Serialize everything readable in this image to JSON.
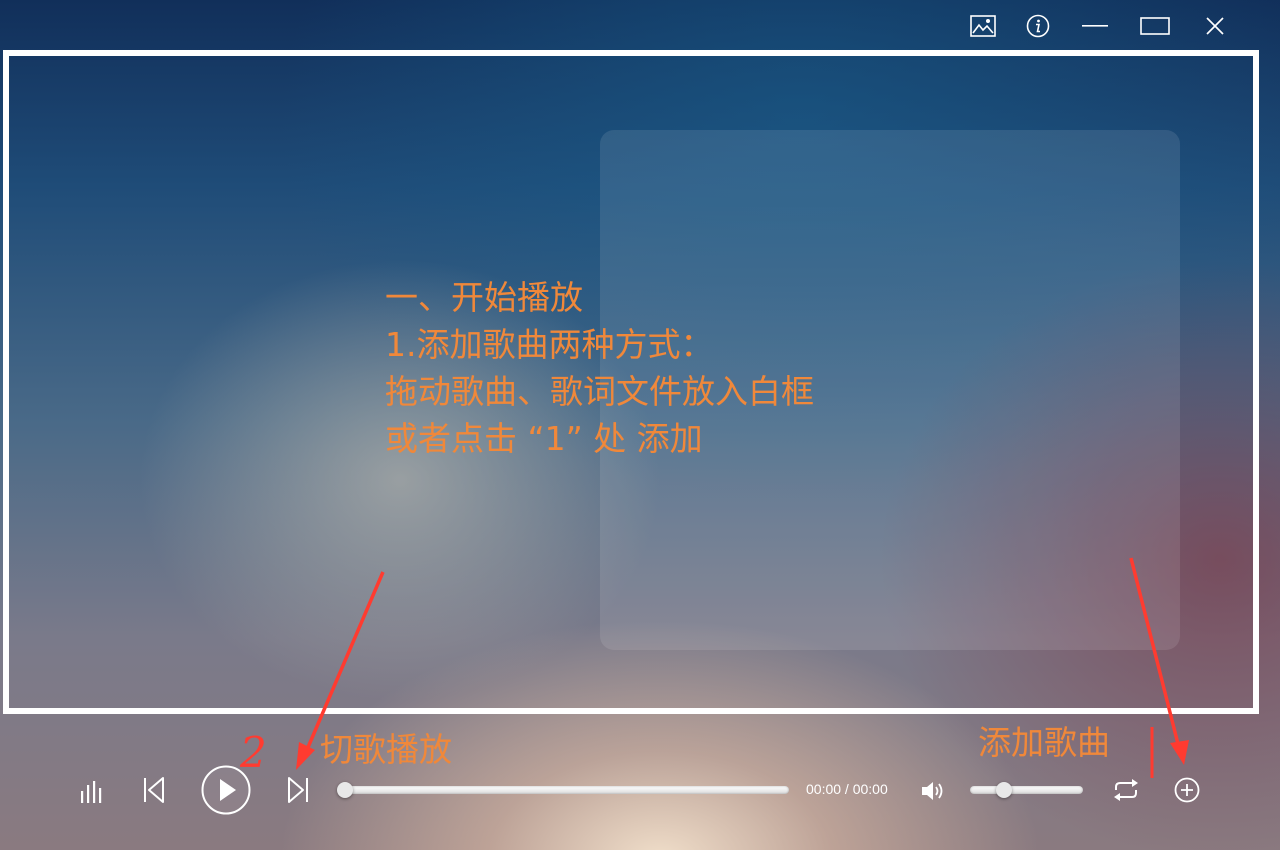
{
  "annotation": {
    "lines": [
      "一、开始播放",
      "1.添加歌曲两种方式：",
      "拖动歌曲、歌词文件放入白框",
      "或者点击 “1” 处 添加"
    ],
    "switch_label": "切歌播放",
    "add_label": "添加歌曲",
    "marker_number": "2",
    "color": "#f0883a",
    "arrow_color": "#ff3b30"
  },
  "player": {
    "time_display": "00:00 / 00:00",
    "progress": 0,
    "volume": 0.3
  },
  "icons": {
    "top": [
      "image-icon",
      "info-icon",
      "minimize-icon",
      "maximize-icon",
      "close-icon"
    ],
    "bottom": [
      "equalizer-icon",
      "previous-icon",
      "play-icon",
      "next-icon",
      "volume-icon",
      "repeat-icon",
      "add-icon"
    ]
  }
}
